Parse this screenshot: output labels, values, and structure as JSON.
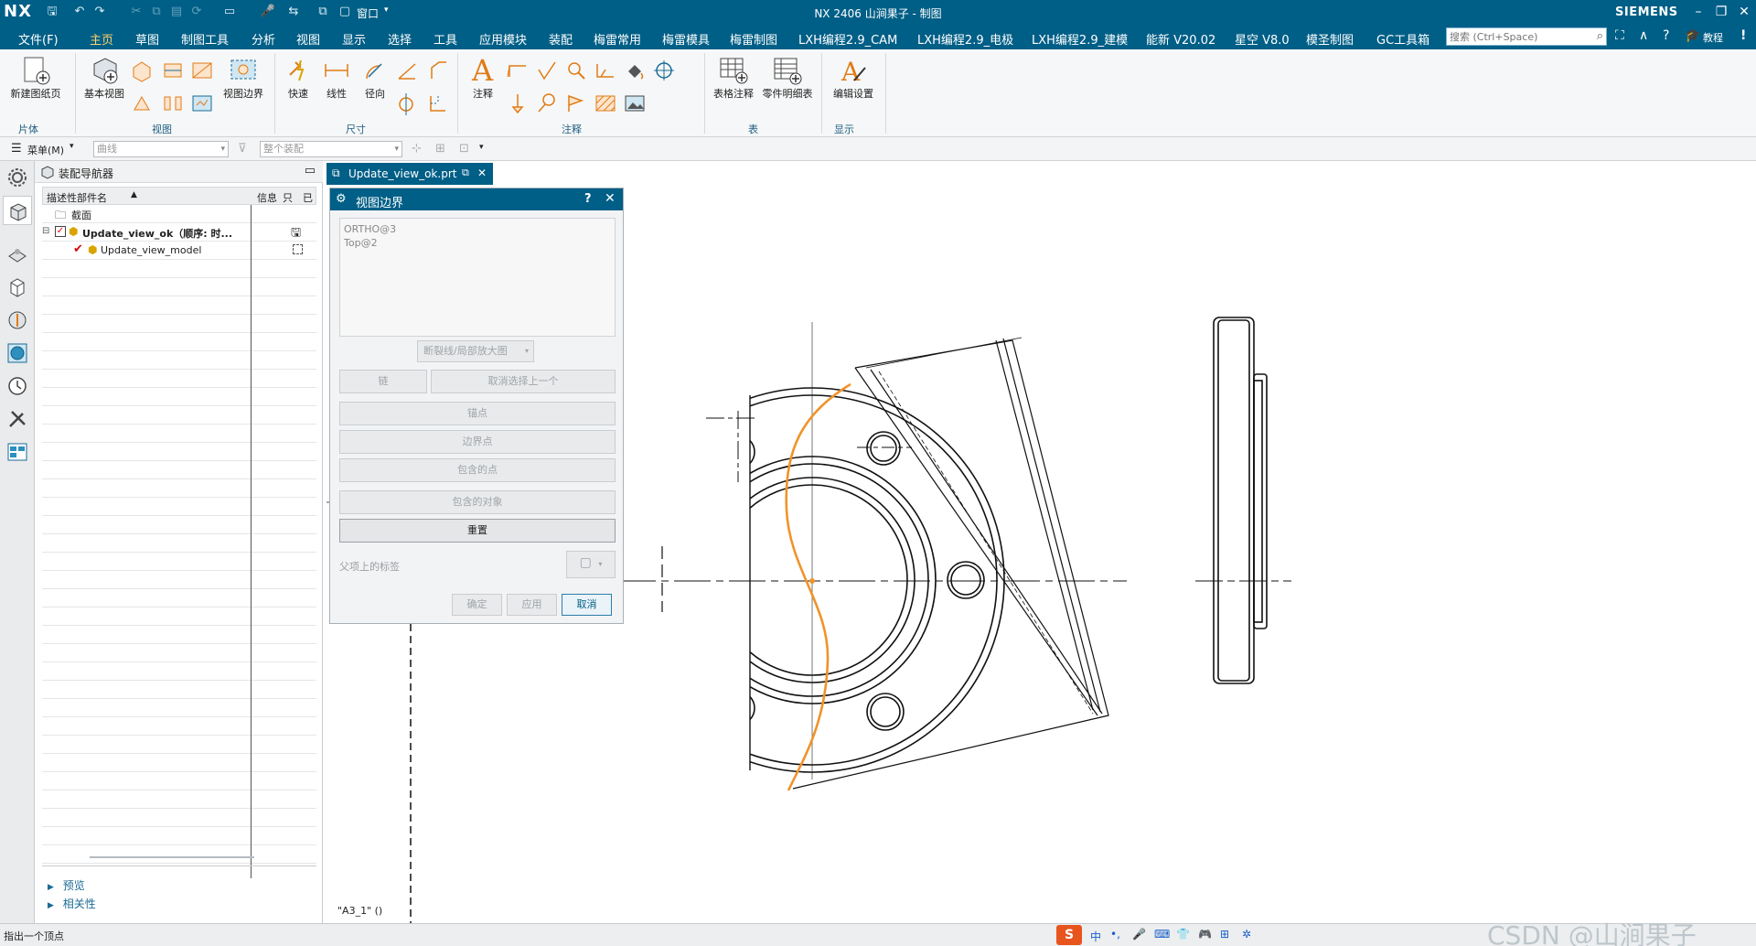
{
  "titlebar": {
    "logo": "NX",
    "title": "NX 2406 山涧果子 - 制图",
    "window_menu_label": "窗口",
    "brand": "SIEMENS"
  },
  "menubar": {
    "items": [
      "文件(F)",
      "主页",
      "草图",
      "制图工具",
      "分析",
      "视图",
      "显示",
      "选择",
      "工具",
      "应用模块",
      "装配",
      "梅雷常用",
      "梅雷模具",
      "梅雷制图",
      "LXH编程2.9_CAM",
      "LXH编程2.9_电极",
      "LXH编程2.9_建模",
      "能新 V20.02",
      "星空 V8.0",
      "模圣制图",
      "GC工具箱"
    ],
    "active_index": 1,
    "search_placeholder": "搜索 (Ctrl+Space)",
    "tutorial_label": "教程"
  },
  "ribbon": {
    "buttons": {
      "new_sheet": "新建图纸页",
      "base_view": "基本视图",
      "view_boundary": "视图边界",
      "rapid": "快速",
      "linear": "线性",
      "radial": "径向",
      "note": "注释",
      "table_note": "表格注释",
      "parts_list": "零件明细表",
      "edit_settings": "编辑设置"
    },
    "groups": {
      "sheet": "片体",
      "view": "视图",
      "dimension": "尺寸",
      "annotation": "注释",
      "table": "表",
      "display": "显示"
    }
  },
  "toolrow": {
    "menu_label": "菜单(M)",
    "filter_value": "曲线",
    "scope_value": "整个装配"
  },
  "navigator": {
    "title": "装配导航器",
    "col_name": "描述性部件名",
    "col_info": "信息",
    "col_r": "只",
    "col_m": "已",
    "rows": [
      "截面",
      "Update_view_ok（顺序: 时...",
      "Update_view_model"
    ],
    "bottom_sections": [
      "预览",
      "相关性"
    ]
  },
  "doc_tab": {
    "label": "Update_view_ok.prt"
  },
  "dialog": {
    "title": "视图边界",
    "list_items": [
      "ORTHO@3",
      "Top@2"
    ],
    "boundary_type": "断裂线/局部放大图",
    "buttons": {
      "chain": "链",
      "deselect_previous": "取消选择上一个",
      "anchor_point": "锚点",
      "boundary_point": "边界点",
      "contained_points": "包含的点",
      "contained_objects": "包含的对象",
      "reset": "重置"
    },
    "parent_label": "父项上的标签",
    "ok": "确定",
    "apply": "应用",
    "cancel": "取消"
  },
  "canvas": {
    "sheet_label": "\"A3_1\" ()"
  },
  "statusbar": {
    "message": "指出一个顶点",
    "ime_label": "中",
    "watermark": "CSDN @山涧果子"
  },
  "colors": {
    "brand_blue": "#005f87",
    "accent_yellow": "#ffd26a",
    "boundary_orange": "#f0932b"
  }
}
